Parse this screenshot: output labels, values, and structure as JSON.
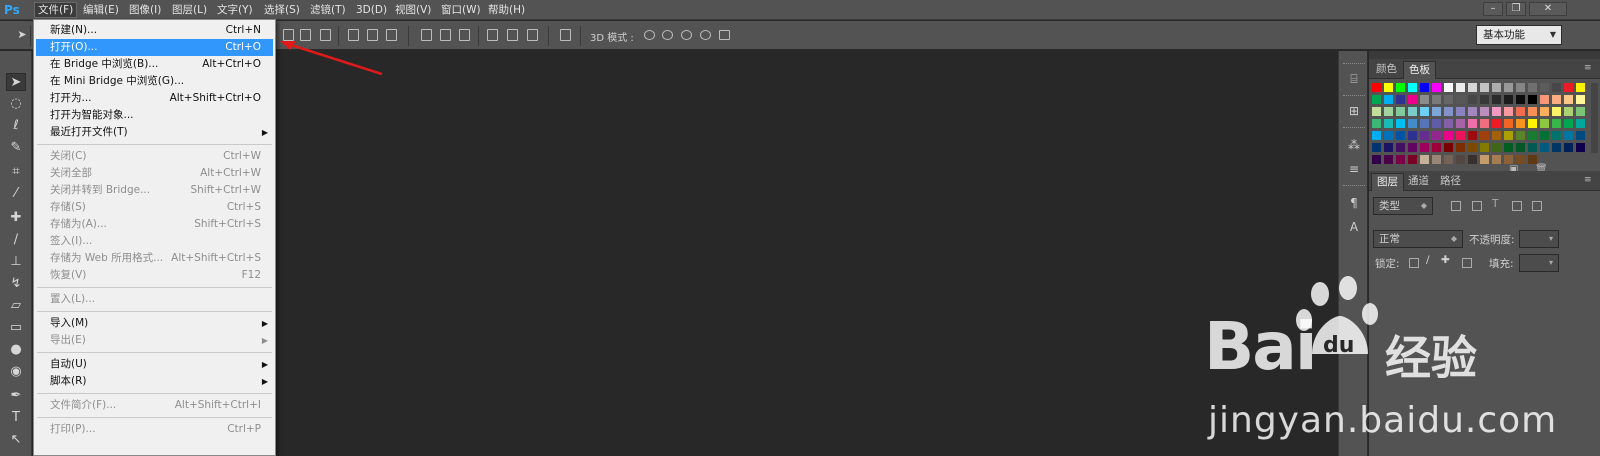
{
  "app": {
    "logo": "Ps"
  },
  "menubar": {
    "items": [
      "文件(F)",
      "编辑(E)",
      "图像(I)",
      "图层(L)",
      "文字(Y)",
      "选择(S)",
      "滤镜(T)",
      "3D(D)",
      "视图(V)",
      "窗口(W)",
      "帮助(H)"
    ],
    "active_index": 0
  },
  "window_controls": {
    "minimize": "–",
    "restore": "❐",
    "close": "✕"
  },
  "options_bar": {
    "mode_3d_label": "3D 模式 :",
    "workspace": "基本功能"
  },
  "file_menu": {
    "items": [
      {
        "label": "新建(N)...",
        "shortcut": "Ctrl+N",
        "disabled": false
      },
      {
        "label": "打开(O)...",
        "shortcut": "Ctrl+O",
        "disabled": false,
        "highlight": true
      },
      {
        "label": "在 Bridge 中浏览(B)...",
        "shortcut": "Alt+Ctrl+O",
        "disabled": false
      },
      {
        "label": "在 Mini Bridge 中浏览(G)...",
        "shortcut": "",
        "disabled": false
      },
      {
        "label": "打开为...",
        "shortcut": "Alt+Shift+Ctrl+O",
        "disabled": false
      },
      {
        "label": "打开为智能对象...",
        "shortcut": "",
        "disabled": false
      },
      {
        "label": "最近打开文件(T)",
        "shortcut": "",
        "disabled": false,
        "submenu": true
      },
      {
        "separator": true
      },
      {
        "label": "关闭(C)",
        "shortcut": "Ctrl+W",
        "disabled": true
      },
      {
        "label": "关闭全部",
        "shortcut": "Alt+Ctrl+W",
        "disabled": true
      },
      {
        "label": "关闭并转到 Bridge...",
        "shortcut": "Shift+Ctrl+W",
        "disabled": true
      },
      {
        "label": "存储(S)",
        "shortcut": "Ctrl+S",
        "disabled": true
      },
      {
        "label": "存储为(A)...",
        "shortcut": "Shift+Ctrl+S",
        "disabled": true
      },
      {
        "label": "签入(I)...",
        "shortcut": "",
        "disabled": true
      },
      {
        "label": "存储为 Web 所用格式...",
        "shortcut": "Alt+Shift+Ctrl+S",
        "disabled": true
      },
      {
        "label": "恢复(V)",
        "shortcut": "F12",
        "disabled": true
      },
      {
        "separator": true
      },
      {
        "label": "置入(L)...",
        "shortcut": "",
        "disabled": true
      },
      {
        "separator": true
      },
      {
        "label": "导入(M)",
        "shortcut": "",
        "disabled": false,
        "submenu": true
      },
      {
        "label": "导出(E)",
        "shortcut": "",
        "disabled": true,
        "submenu": true
      },
      {
        "separator": true
      },
      {
        "label": "自动(U)",
        "shortcut": "",
        "disabled": false,
        "submenu": true
      },
      {
        "label": "脚本(R)",
        "shortcut": "",
        "disabled": false,
        "submenu": true
      },
      {
        "separator": true
      },
      {
        "label": "文件简介(F)...",
        "shortcut": "Alt+Shift+Ctrl+I",
        "disabled": true
      },
      {
        "separator": true
      },
      {
        "label": "打印(P)...",
        "shortcut": "Ctrl+P",
        "disabled": true
      }
    ]
  },
  "swatches_panel": {
    "tabs": [
      "颜色",
      "色板"
    ],
    "active_tab": 1,
    "colors": [
      "#ff0000",
      "#ffff00",
      "#00ff00",
      "#00ffff",
      "#0000ff",
      "#ff00ff",
      "#ffffff",
      "#ebebeb",
      "#d6d6d6",
      "#c2c2c2",
      "#adadad",
      "#999999",
      "#858585",
      "#707070",
      "#5c5c5c",
      "#474747",
      "#ed1c24",
      "#fff200",
      "#00a651",
      "#00aeef",
      "#2e3192",
      "#ec008c",
      "#8c8c8c",
      "#7a7a7a",
      "#666666",
      "#575757",
      "#474747",
      "#383838",
      "#2b2b2b",
      "#1c1c1c",
      "#0d0d0d",
      "#000000",
      "#f7977a",
      "#fbad82",
      "#fdc689",
      "#fff79a",
      "#c4df9b",
      "#a3d39c",
      "#82ca9c",
      "#7accc8",
      "#6dcff6",
      "#7da7d8",
      "#8393ca",
      "#8882be",
      "#a187be",
      "#bc8dbf",
      "#f49ac2",
      "#f6989d",
      "#f26c4f",
      "#f68e55",
      "#fbaf5c",
      "#fff467",
      "#acd372",
      "#7cc576",
      "#3bb878",
      "#1abbb4",
      "#00bff3",
      "#438cca",
      "#5574b9",
      "#605ca8",
      "#855fa8",
      "#a763a8",
      "#f06ea9",
      "#f26d7d",
      "#ed1c24",
      "#f26522",
      "#f7941d",
      "#fff200",
      "#8dc73f",
      "#39b54a",
      "#00a651",
      "#00a99d",
      "#00aeef",
      "#0072bc",
      "#0054a6",
      "#2e3192",
      "#662d91",
      "#92278f",
      "#ec008c",
      "#ed145b",
      "#9e0b0f",
      "#a0410d",
      "#a3620a",
      "#aba000",
      "#598527",
      "#197b30",
      "#007236",
      "#00746b",
      "#0076a3",
      "#004a80",
      "#003471",
      "#1b1464",
      "#440e62",
      "#630460",
      "#9e005d",
      "#9e0039",
      "#790000",
      "#7b2e00",
      "#7d4900",
      "#827b00",
      "#406618",
      "#005e20",
      "#005826",
      "#005952",
      "#005b7f",
      "#003663",
      "#002157",
      "#0d004c",
      "#32004b",
      "#4b0049",
      "#7b0046",
      "#7a0026",
      "#c7b299",
      "#998675",
      "#736357",
      "#534741",
      "#37302d",
      "#c69c6d",
      "#a67c52",
      "#8c6239",
      "#754c24",
      "#603913"
    ]
  },
  "layers_panel": {
    "tabs": [
      "图层",
      "通道",
      "路径"
    ],
    "active_tab": 0,
    "filter_kind": "类型",
    "blend_mode": "正常",
    "opacity_label": "不透明度:",
    "lock_label": "锁定:",
    "fill_label": "填充:"
  },
  "watermark": {
    "brand": "Bai",
    "brand2": "经验",
    "url": "jingyan.baidu.com"
  }
}
